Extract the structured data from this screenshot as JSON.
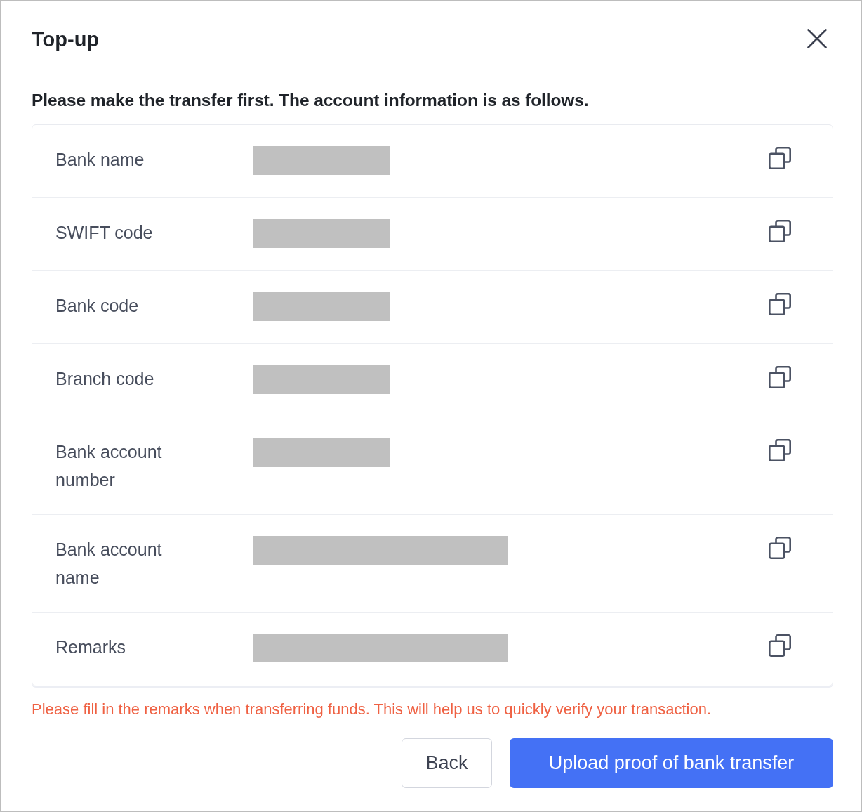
{
  "dialog": {
    "title": "Top-up",
    "instruction": "Please make the transfer first. The account information is as follows.",
    "fields": [
      {
        "label": "Bank name",
        "kind": "short"
      },
      {
        "label": "SWIFT code",
        "kind": "short"
      },
      {
        "label": "Bank code",
        "kind": "short"
      },
      {
        "label": "Branch code",
        "kind": "short"
      },
      {
        "label": "Bank account number",
        "kind": "short"
      },
      {
        "label": "Bank account name",
        "kind": "long"
      },
      {
        "label": "Remarks",
        "kind": "long"
      }
    ],
    "note": "Please fill in the remarks when transferring funds. This will help us to quickly verify your transaction.",
    "buttons": [
      {
        "label": "Back",
        "kind": "secondary"
      },
      {
        "label": "Upload proof of bank transfer",
        "kind": "primary"
      }
    ]
  }
}
